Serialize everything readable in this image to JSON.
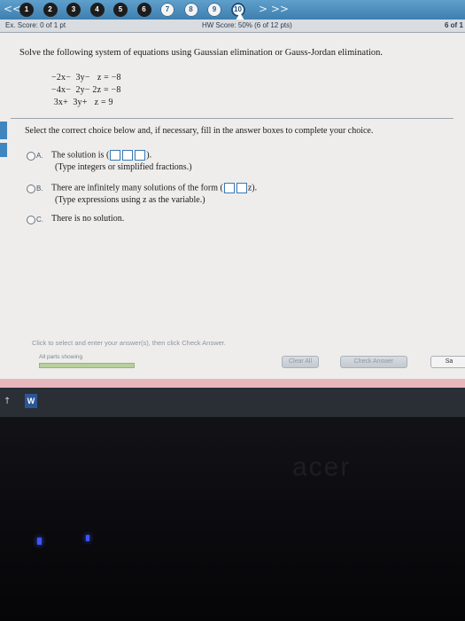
{
  "nav": {
    "prev_arrows": "<<",
    "next_arrows": "> >>",
    "questions": [
      {
        "label": "1",
        "state": "done"
      },
      {
        "label": "2",
        "state": "done"
      },
      {
        "label": "3",
        "state": "done"
      },
      {
        "label": "4",
        "state": "done"
      },
      {
        "label": "5",
        "state": "done"
      },
      {
        "label": "6",
        "state": "done"
      },
      {
        "label": "7",
        "state": "todo"
      },
      {
        "label": "8",
        "state": "todo"
      },
      {
        "label": "9",
        "state": "todo"
      },
      {
        "label": "10",
        "state": "current"
      }
    ]
  },
  "score": {
    "ex_score": "Ex. Score: 0 of 1 pt",
    "hw_score": "HW Score: 50% (6 of 12 pts)",
    "right_text": "6 of 1"
  },
  "question": {
    "prompt": "Solve the following system of equations using Gaussian elimination or Gauss-Jordan elimination.",
    "equations": [
      "−2x−  3y−   z = −8",
      "−4x−  2y− 2z = −8",
      " 3x+  3y+   z = 9"
    ],
    "instruction": "Select the correct choice below and, if necessary, fill in the answer boxes to complete your choice.",
    "options": [
      {
        "label": "A.",
        "text": "The solution is (",
        "suffix": ").",
        "hint": "(Type integers or simplified fractions.)"
      },
      {
        "label": "B.",
        "text": "There are infinitely many solutions of the form (",
        "suffix": "z).",
        "hint": "(Type expressions using z as the variable.)"
      },
      {
        "label": "C.",
        "text": "There is no solution.",
        "suffix": "",
        "hint": ""
      }
    ]
  },
  "footer": {
    "hint": "Click to select and enter your answer(s), then click Check Answer.",
    "all_parts": "All parts showing",
    "progress_pct": 100,
    "clear_all": "Clear All",
    "check_answer": "Check Answer",
    "save": "Sa"
  },
  "taskbar": {
    "app_icon": "W",
    "arrow": "↑"
  },
  "bezel": {
    "brand": "acer"
  },
  "colors": {
    "nav_blue": "#3e7fb0",
    "answer_box": "#3a79b5",
    "pink_bar": "#e8b6bd"
  }
}
